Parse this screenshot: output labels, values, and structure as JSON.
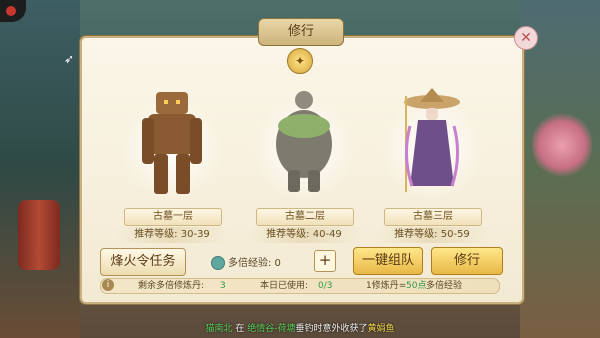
{
  "window": {
    "title": "修行"
  },
  "close_icon": "close-icon",
  "levels": [
    {
      "name": "古墓一层",
      "recommend": "推荐等级: 30-39",
      "monster": "wooden-golem-icon",
      "color": "#8a5a32"
    },
    {
      "name": "古墓二层",
      "recommend": "推荐等级: 40-49",
      "monster": "stone-golem-icon",
      "color": "#7d7a6e"
    },
    {
      "name": "古墓三层",
      "recommend": "推荐等级: 50-59",
      "monster": "witch-hat-icon",
      "color": "#6f4f8a"
    }
  ],
  "actions": {
    "mission": "烽火令任务",
    "multi_exp_label": "多倍经验: 0",
    "plus": "+",
    "team": "一键组队",
    "practice": "修行"
  },
  "info": {
    "remaining_label": "剩余多倍修炼丹:",
    "remaining_value": "3",
    "used_label": "本日已使用:",
    "used_value": "0/3",
    "rule_prefix": "1修炼丹=",
    "rule_value": "50点",
    "rule_suffix": "多倍经验"
  },
  "chat": {
    "player": "猫南北",
    "mid1": " 在 ",
    "place": "绝情谷-荷塘",
    "mid2": "垂钓时意外收获了",
    "item": "黄娟鱼"
  }
}
